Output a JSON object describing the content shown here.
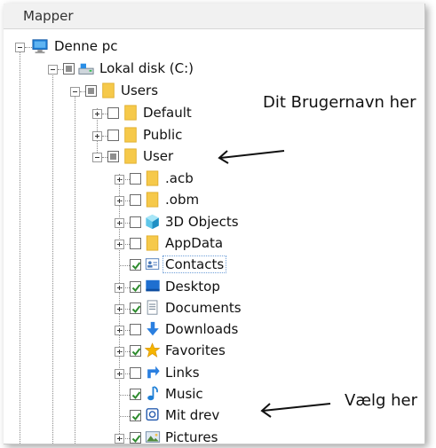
{
  "panel": {
    "title": "Mapper"
  },
  "tree": {
    "root": {
      "label": "Denne pc",
      "icon": "computer-icon"
    },
    "drive": {
      "label": "Lokal disk (C:)",
      "icon": "drive-icon"
    },
    "users": {
      "label": "Users",
      "icon": "folder-icon"
    },
    "default": {
      "label": "Default",
      "icon": "folder-icon"
    },
    "public": {
      "label": "Public",
      "icon": "folder-icon"
    },
    "user": {
      "label": "User",
      "icon": "folder-icon"
    },
    "children": [
      {
        "label": ".acb",
        "icon": "folder-icon",
        "checked": false,
        "expandable": true
      },
      {
        "label": ".obm",
        "icon": "folder-icon",
        "checked": false,
        "expandable": true
      },
      {
        "label": "3D Objects",
        "icon": "3d-objects-icon",
        "checked": false,
        "expandable": true
      },
      {
        "label": "AppData",
        "icon": "folder-icon",
        "checked": false,
        "expandable": true
      },
      {
        "label": "Contacts",
        "icon": "contacts-icon",
        "checked": true,
        "expandable": false,
        "selected": true
      },
      {
        "label": "Desktop",
        "icon": "desktop-icon",
        "checked": true,
        "expandable": true
      },
      {
        "label": "Documents",
        "icon": "documents-icon",
        "checked": true,
        "expandable": true
      },
      {
        "label": "Downloads",
        "icon": "downloads-icon",
        "checked": false,
        "expandable": true
      },
      {
        "label": "Favorites",
        "icon": "favorites-star-icon",
        "checked": true,
        "expandable": true
      },
      {
        "label": "Links",
        "icon": "links-icon",
        "checked": false,
        "expandable": true
      },
      {
        "label": "Music",
        "icon": "music-icon",
        "checked": true,
        "expandable": false
      },
      {
        "label": "Mit drev",
        "icon": "mit-drev-icon",
        "checked": true,
        "expandable": false
      },
      {
        "label": "Pictures",
        "icon": "pictures-icon",
        "checked": true,
        "expandable": true
      }
    ]
  },
  "annotations": {
    "username_hint": "Dit Brugernavn her",
    "choose_hint": "Vælg her"
  },
  "colors": {
    "check_green": "#2e8b2e",
    "folder": "#f6c94a",
    "selection": "#6f9fd8"
  }
}
